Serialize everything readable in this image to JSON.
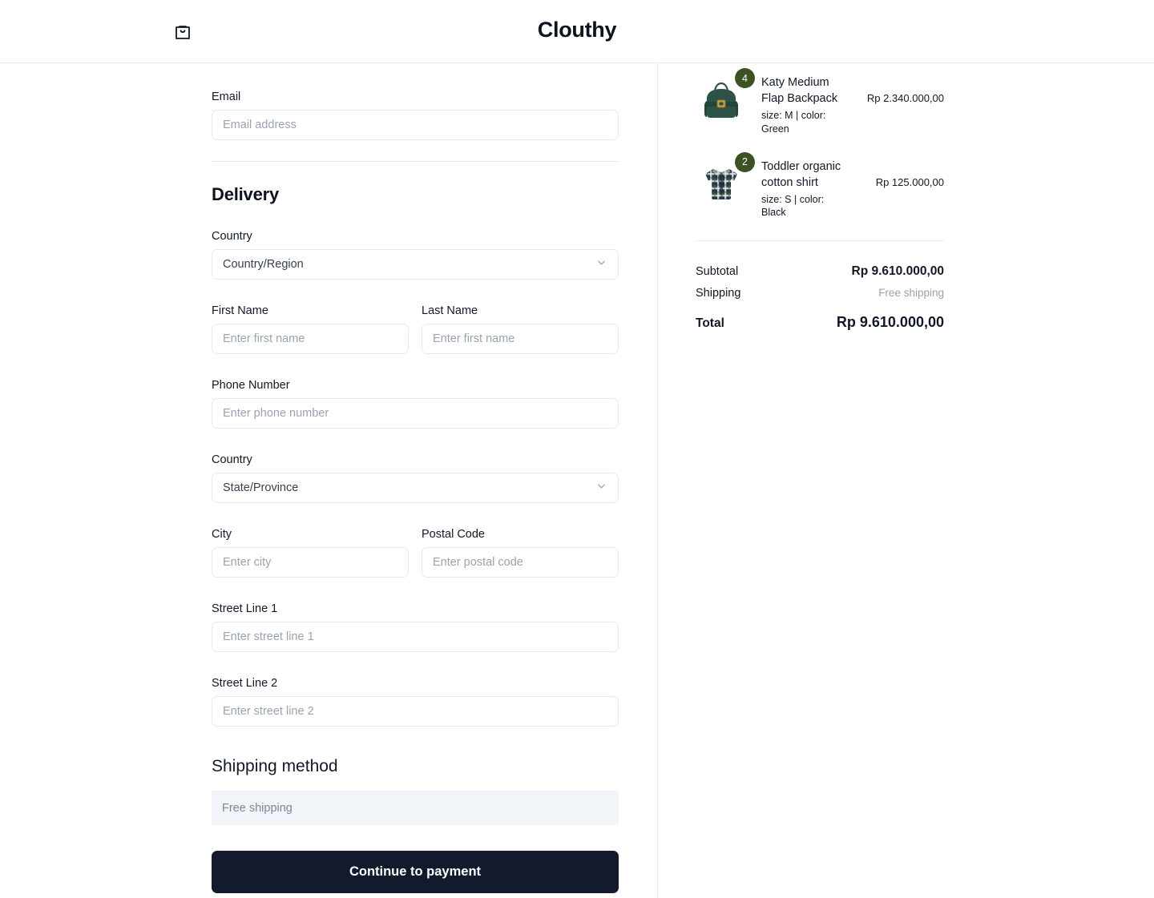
{
  "header": {
    "brand": "Clouthy",
    "bag_icon": "shopping-bag-icon"
  },
  "form": {
    "email": {
      "label": "Email",
      "placeholder": "Email address",
      "value": ""
    },
    "delivery_heading": "Delivery",
    "country": {
      "label": "Country",
      "selected": "Country/Region"
    },
    "first_name": {
      "label": "First Name",
      "placeholder": "Enter first name",
      "value": ""
    },
    "last_name": {
      "label": "Last Name",
      "placeholder": "Enter first name",
      "value": ""
    },
    "phone": {
      "label": "Phone Number",
      "placeholder": "Enter phone number",
      "value": ""
    },
    "state": {
      "label": "Country",
      "selected": "State/Province"
    },
    "city": {
      "label": "City",
      "placeholder": "Enter city",
      "value": ""
    },
    "postal_code": {
      "label": "Postal Code",
      "placeholder": "Enter postal code",
      "value": ""
    },
    "street1": {
      "label": "Street Line 1",
      "placeholder": "Enter street line 1",
      "value": ""
    },
    "street2": {
      "label": "Street Line 2",
      "placeholder": "Enter street line 2",
      "value": ""
    },
    "shipping_heading": "Shipping method",
    "shipping_option": "Free shipping",
    "submit_label": "Continue to payment"
  },
  "summary": {
    "items": [
      {
        "title": "Katy Medium Flap Backpack",
        "variant": "size: M | color: Green",
        "price": "Rp 2.340.000,00",
        "qty": "4",
        "image": "green-backpack"
      },
      {
        "title": "Toddler organic cotton shirt",
        "variant": "size: S | color: Black",
        "price": "Rp 125.000,00",
        "qty": "2",
        "image": "plaid-shirt"
      }
    ],
    "subtotal_label": "Subtotal",
    "subtotal_value": "Rp 9.610.000,00",
    "shipping_label": "Shipping",
    "shipping_value": "Free shipping",
    "total_label": "Total",
    "total_value": "Rp 9.610.000,00"
  },
  "colors": {
    "button": "#131a2c",
    "badge": "#3d5124",
    "panel": "#f1f4f9"
  }
}
